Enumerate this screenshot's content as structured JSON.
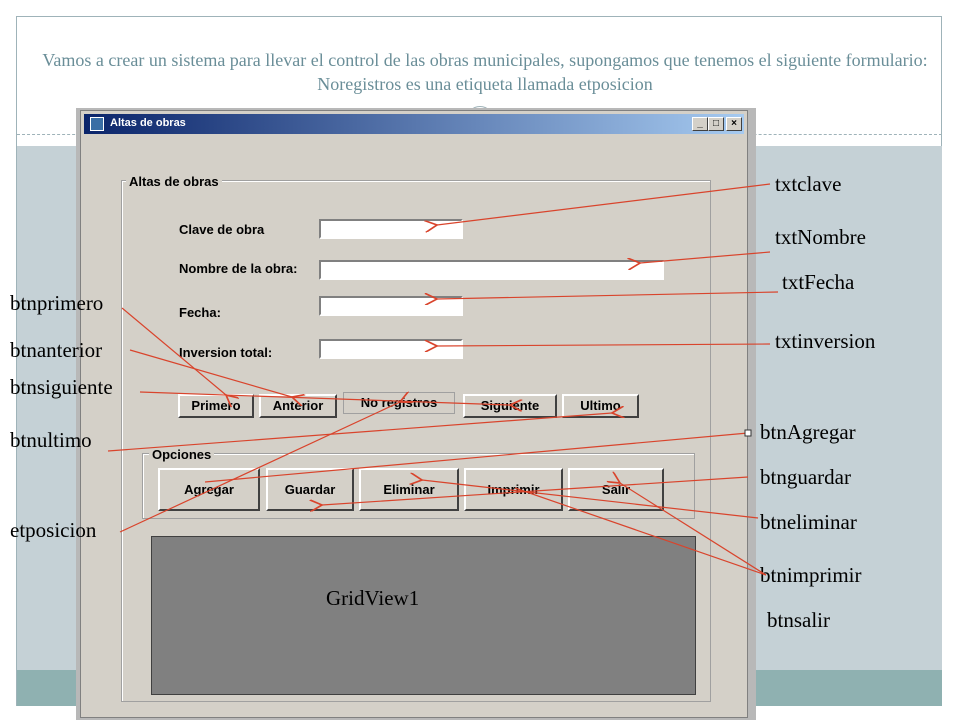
{
  "slide": {
    "title": "Vamos a crear un sistema para llevar el control de las obras municipales, supongamos que tenemos el siguiente formulario: Noregistros es una etiqueta llamada etposicion"
  },
  "window": {
    "title": "Altas de obras",
    "controls": [
      "_",
      "□",
      "×"
    ]
  },
  "form": {
    "group_title": "Altas de obras",
    "fields": [
      {
        "label": "Clave de obra",
        "value": ""
      },
      {
        "label": "Nombre de la obra:",
        "value": ""
      },
      {
        "label": "Fecha:",
        "value": ""
      },
      {
        "label": "Inversion total:",
        "value": ""
      }
    ],
    "nav_buttons": [
      "Primero",
      "Anterior",
      "Siguiente",
      "Ultimo"
    ],
    "position_label": "No registros",
    "options_title": "Opciones",
    "option_buttons": [
      "Agregar",
      "Guardar",
      "Eliminar",
      "Imprimir",
      "Salir"
    ],
    "grid_label": "GridView1"
  },
  "annotations": {
    "right": [
      "txtclave",
      "txtNombre",
      "txtFecha",
      "txtinversion",
      "btnAgregar",
      "btnguardar",
      "btneliminar",
      "btnimprimir",
      "btnsalir"
    ],
    "left": [
      "btnprimero",
      "btnanterior",
      "btnsiguiente",
      "btnultimo",
      "etposicion"
    ]
  },
  "colors": {
    "arrow": "#d9442c",
    "slide_band": "#c5d1d6",
    "footer_band": "#8fb1b1",
    "title_text": "#6a8e98"
  }
}
